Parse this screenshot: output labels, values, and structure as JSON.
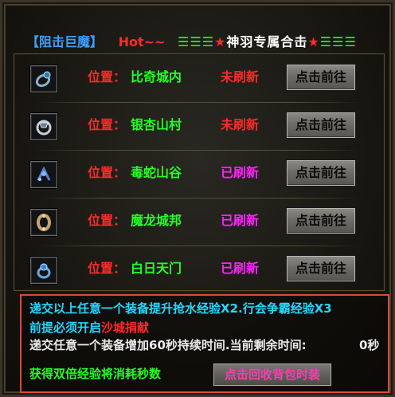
{
  "header": {
    "bracket_title": "【阻击巨魔】",
    "hot": "Hot~~",
    "deco_left": "☰☰☰",
    "star_left": "★",
    "title": "神羽专属合击",
    "star_right": "★",
    "deco_right": "☰☰☰"
  },
  "rows": [
    {
      "label": "位置：",
      "location": "比奇城内",
      "status": "未刷新",
      "status_color": "#ff2a2a",
      "button": "点击前往",
      "icon": "ring-icon"
    },
    {
      "label": "位置：",
      "location": "银杏山村",
      "status": "未刷新",
      "status_color": "#ff2a2a",
      "button": "点击前往",
      "icon": "silver-ring-icon"
    },
    {
      "label": "位置：",
      "location": "毒蛇山谷",
      "status": "已刷新",
      "status_color": "#ff22ff",
      "button": "点击前往",
      "icon": "bracelet-icon"
    },
    {
      "label": "位置：",
      "location": "魔龙城邦",
      "status": "已刷新",
      "status_color": "#ff22ff",
      "button": "点击前往",
      "icon": "gold-bracelet-icon"
    },
    {
      "label": "位置：",
      "location": "白日天门",
      "status": "已刷新",
      "status_color": "#ff22ff",
      "button": "点击前往",
      "icon": "gem-ring-icon"
    }
  ],
  "info": {
    "line1": "递交以上任意一个装备提升抢水经验X2.行会争霸经验X3",
    "line2_prefix": "前提必须开启",
    "line2_warn": "沙城捐献",
    "line3": "递交任意一个装备增加60秒持续时间.当前剩余时间:",
    "remaining": "0秒",
    "line4": "获得双倍经验将消耗秒数",
    "recycle_button": "点击回收背包时装"
  }
}
